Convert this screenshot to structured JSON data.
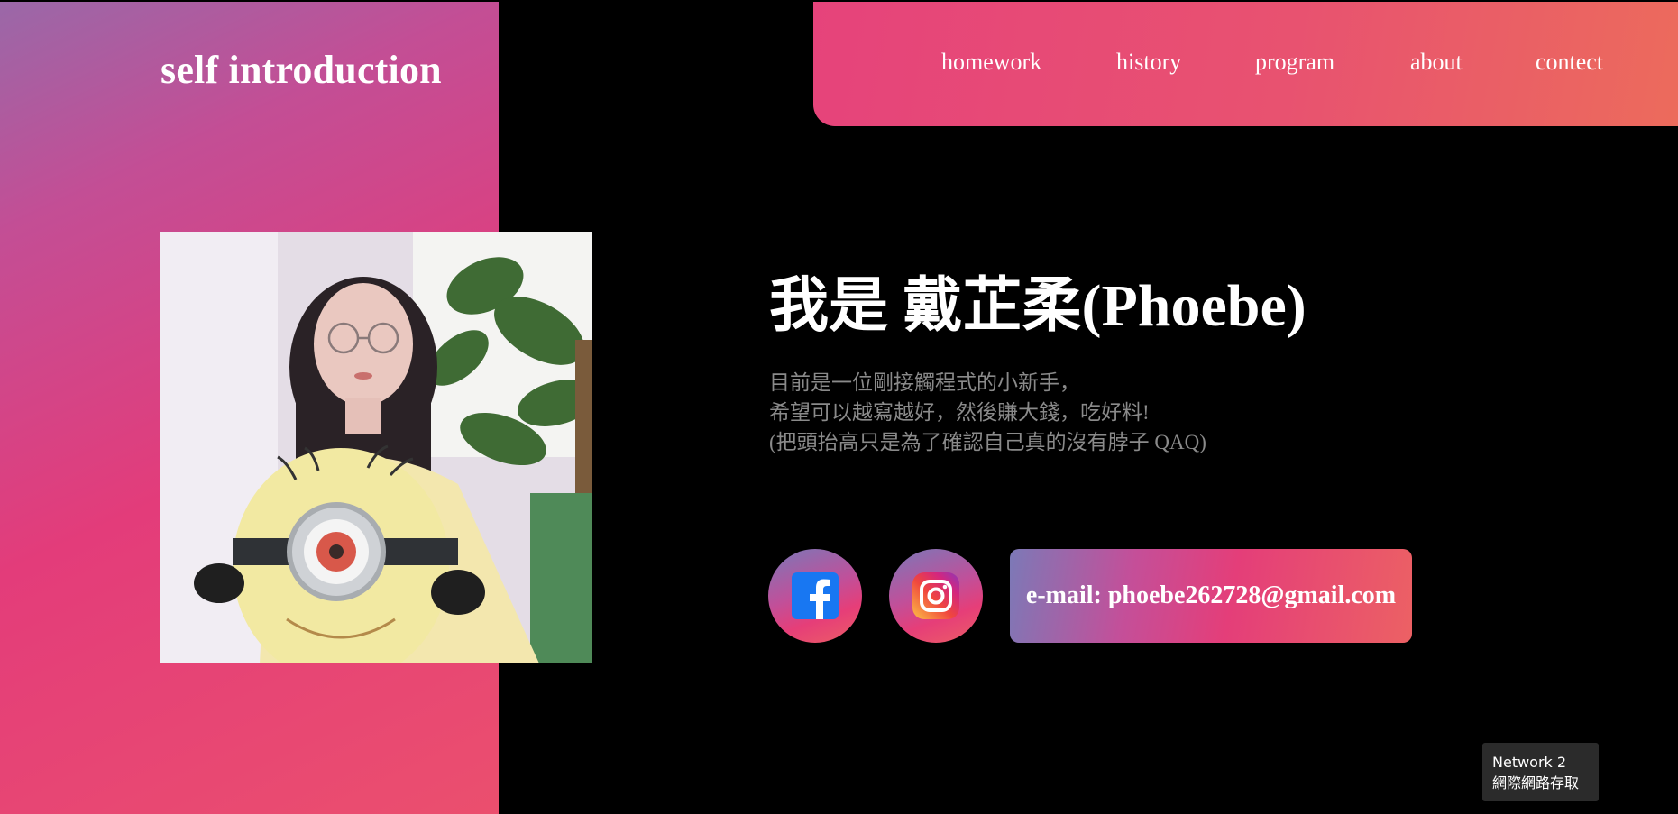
{
  "site": {
    "title": "self introduction"
  },
  "nav": {
    "items": [
      {
        "label": "homework"
      },
      {
        "label": "history"
      },
      {
        "label": "program"
      },
      {
        "label": "about"
      },
      {
        "label": "contect"
      }
    ]
  },
  "profile": {
    "photo_icon": "profile-photo",
    "heading": "我是 戴芷柔(Phoebe)",
    "description": [
      "目前是一位剛接觸程式的小新手，",
      "希望可以越寫越好，然後賺大錢，吃好料!",
      "(把頭抬高只是為了確認自己真的沒有脖子 QAQ)"
    ]
  },
  "social": {
    "facebook_icon": "facebook-icon",
    "instagram_icon": "instagram-icon",
    "email_label": "e-mail: phoebe262728@gmail.com"
  },
  "tooltip": {
    "line1": "Network 2",
    "line2": "網際網路存取"
  },
  "colors": {
    "background": "#000000",
    "accent_pink": "#e33c7a",
    "accent_purple": "#9a68a8",
    "accent_orange": "#ec6b5c",
    "description_text": "#8a8a8a"
  }
}
